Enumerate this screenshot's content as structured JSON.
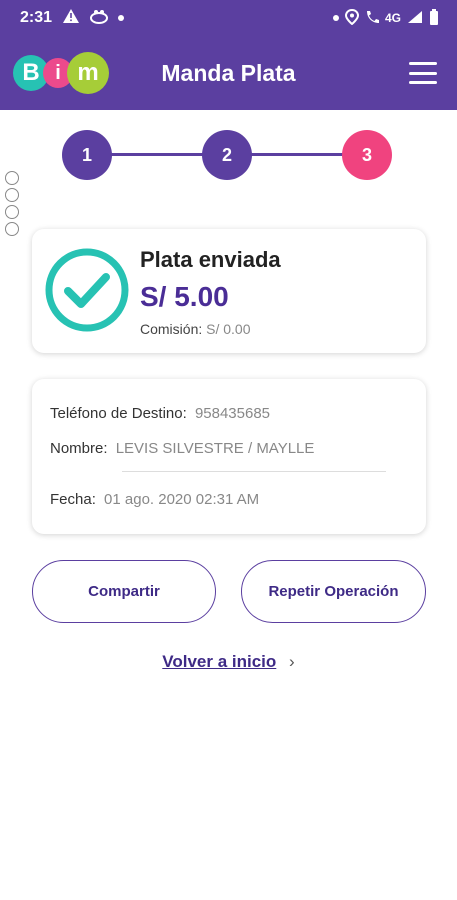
{
  "status_bar": {
    "time": "2:31",
    "network": "4G"
  },
  "header": {
    "logo_letters": [
      "B",
      "i",
      "m"
    ],
    "title": "Manda Plata",
    "menu_icon": "hamburger-menu-icon"
  },
  "stepper": {
    "steps": [
      "1",
      "2",
      "3"
    ],
    "active_step": 3
  },
  "result": {
    "title": "Plata enviada",
    "amount": "S/ 5.00",
    "commission_label": "Comisión:",
    "commission_value": "S/ 0.00",
    "icon": "check-circle-icon"
  },
  "details": {
    "phone_label": "Teléfono de Destino:",
    "phone_value": "958435685",
    "name_label": "Nombre:",
    "name_value": "LEVIS SILVESTRE / MAYLLE",
    "date_label": "Fecha:",
    "date_value": "01 ago. 2020 02:31 AM"
  },
  "actions": {
    "share_label": "Compartir",
    "repeat_label": "Repetir Operación",
    "back_label": "Volver a inicio",
    "back_chevron": "›"
  },
  "colors": {
    "primary": "#5b3fa0",
    "accent": "#f0437f",
    "success": "#27c2b3"
  }
}
